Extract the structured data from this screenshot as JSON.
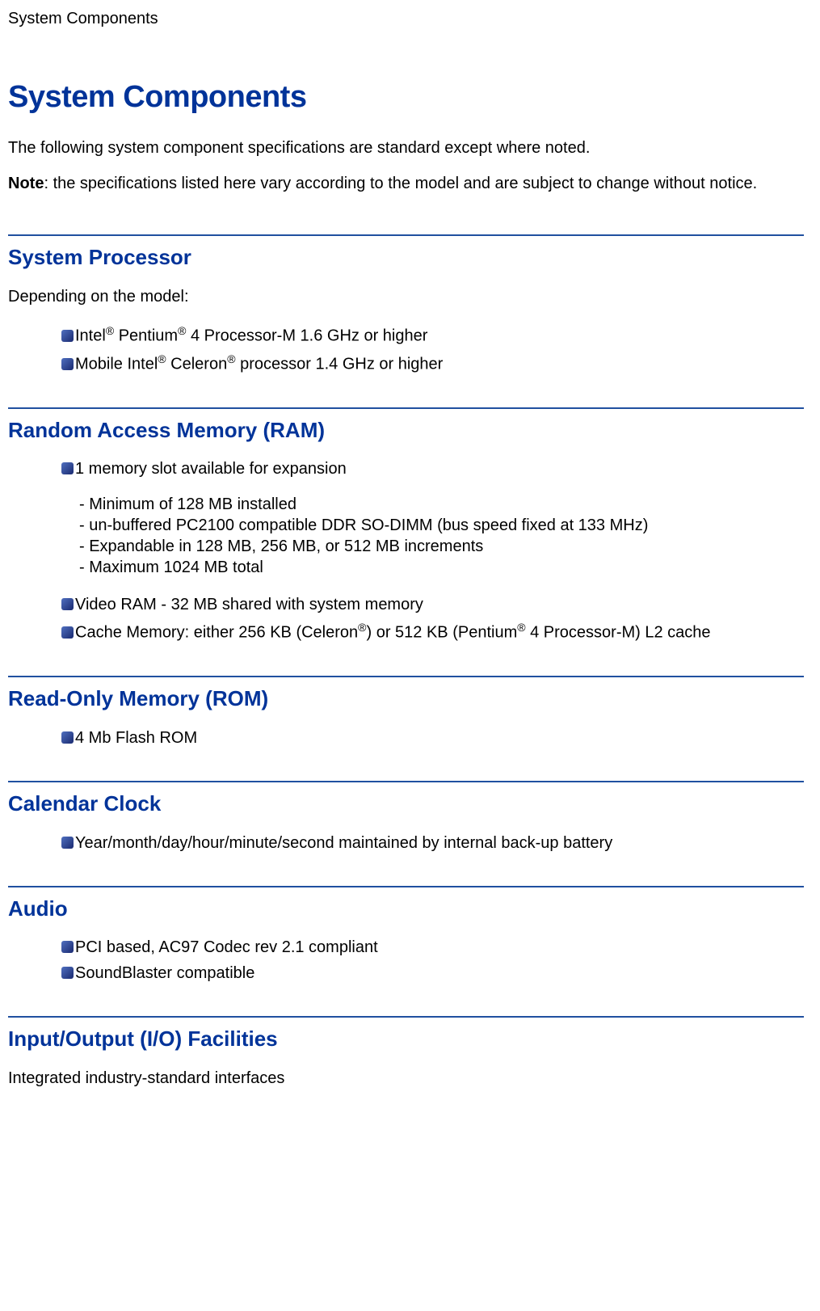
{
  "header": "System Components",
  "title": "System Components",
  "intro": "The following system component specifications are standard except where noted.",
  "note_label": "Note",
  "note_text": ": the specifications listed here vary according to the model and are subject to change without notice.",
  "sections": {
    "processor": {
      "heading": "System Processor",
      "intro": "Depending on the model:",
      "items": {
        "i0_pre": "Intel",
        "i0_sup1": "®",
        "i0_mid": " Pentium",
        "i0_sup2": "®",
        "i0_post": " 4 Processor-M 1.6 GHz or higher",
        "i1_pre": "Mobile Intel",
        "i1_sup1": "®",
        "i1_mid": " Celeron",
        "i1_sup2": "®",
        "i1_post": " processor 1.4 GHz or higher"
      }
    },
    "ram": {
      "heading": "Random Access Memory (RAM)",
      "item0": "1 memory slot available for expansion",
      "sub0": "- Minimum of 128 MB installed",
      "sub1": "- un-buffered PC2100 compatible DDR SO-DIMM (bus speed fixed at 133 MHz)",
      "sub2": "- Expandable in 128 MB, 256 MB, or 512 MB increments",
      "sub3": "- Maximum 1024 MB total",
      "item1": "Video RAM - 32 MB shared with system memory",
      "item2_pre": "Cache Memory: either 256 KB (Celeron",
      "item2_sup1": "®",
      "item2_mid": ") or 512 KB (Pentium",
      "item2_sup2": "®",
      "item2_post": " 4 Processor-M) L2 cache"
    },
    "rom": {
      "heading": "Read-Only Memory (ROM)",
      "item0": "4 Mb Flash ROM"
    },
    "clock": {
      "heading": "Calendar Clock",
      "item0": "Year/month/day/hour/minute/second maintained by internal back-up battery"
    },
    "audio": {
      "heading": "Audio",
      "item0": "PCI based, AC97 Codec rev 2.1 compliant",
      "item1": "SoundBlaster compatible"
    },
    "io": {
      "heading": "Input/Output (I/O) Facilities",
      "intro": "Integrated industry-standard interfaces"
    }
  }
}
